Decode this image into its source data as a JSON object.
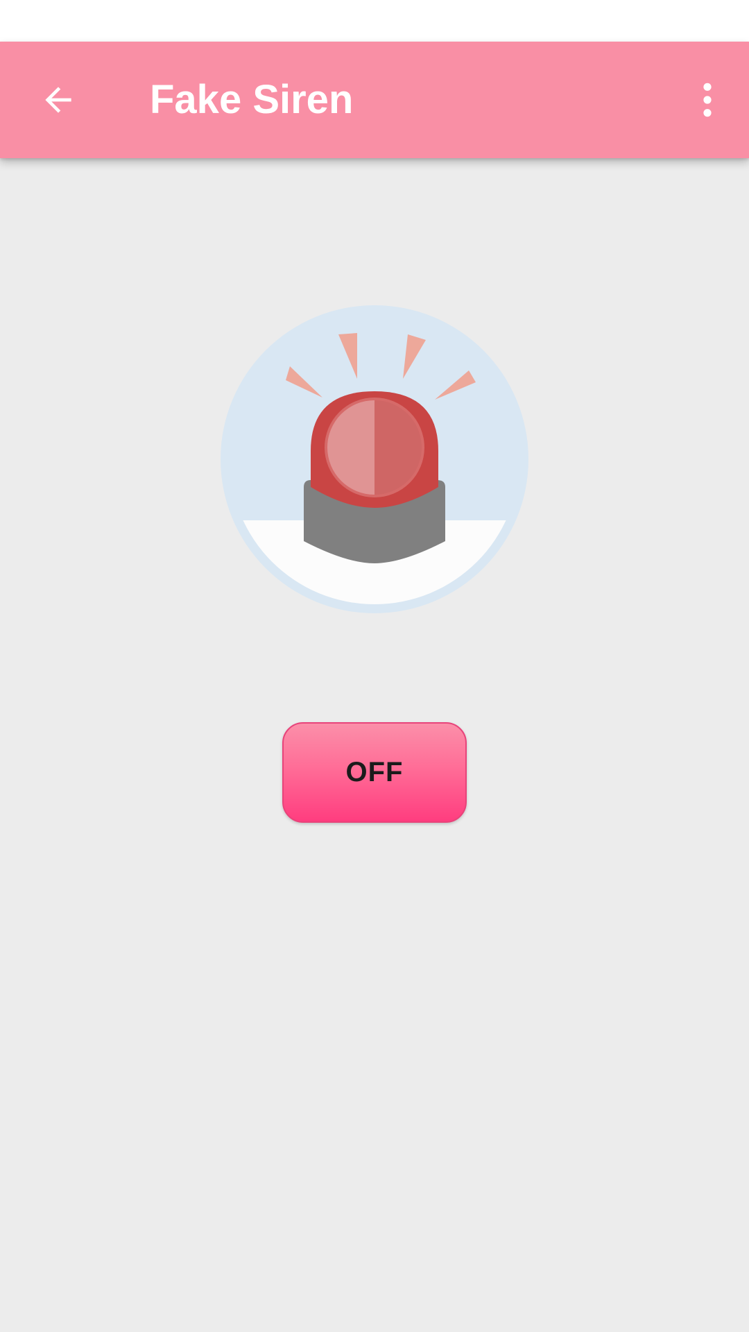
{
  "app_bar": {
    "title": "Fake Siren",
    "back_icon": "arrow-back-icon",
    "overflow_icon": "more-vert-icon",
    "background_color": "#f98fa5"
  },
  "siren": {
    "icon": "siren-icon",
    "circle_color": "#d9e7f3",
    "dome_color": "#c94544",
    "base_color": "#808080",
    "ray_color": "#eda89a"
  },
  "toggle": {
    "label": "OFF",
    "color": "#ff5a8c"
  },
  "screen": {
    "background_color": "#ececec"
  }
}
